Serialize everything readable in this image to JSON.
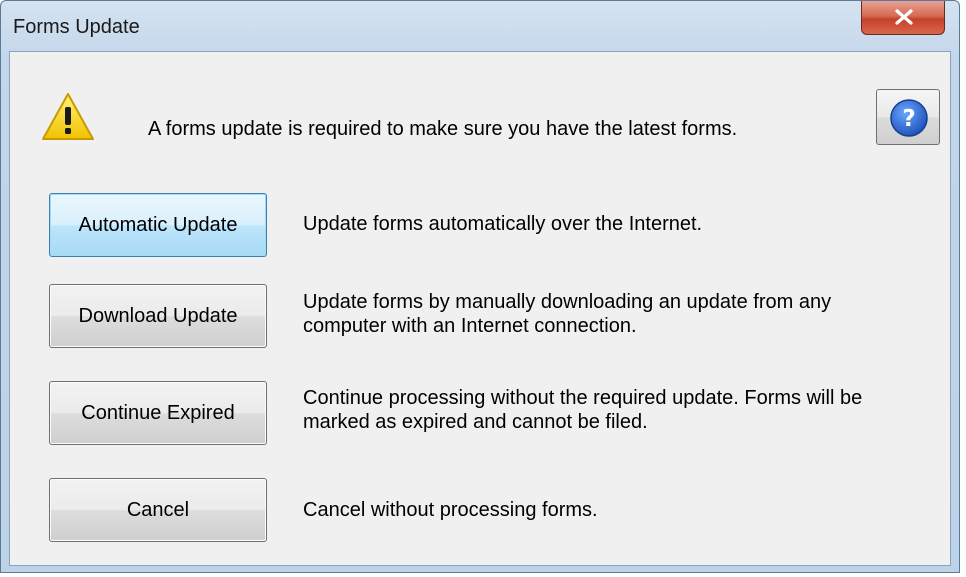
{
  "window": {
    "title": "Forms Update"
  },
  "message": "A forms update is required to make sure you have the latest forms.",
  "icons": {
    "warning": "warning-icon",
    "help": "help-icon",
    "close": "close-icon"
  },
  "options": [
    {
      "button": "Automatic Update",
      "description": "Update forms automatically over the Internet.",
      "default": true
    },
    {
      "button": "Download Update",
      "description_line1": "Update forms by manually downloading an update from any",
      "description_line2": "computer with an Internet connection."
    },
    {
      "button": "Continue Expired",
      "description_line1": "Continue processing without the required update. Forms will be",
      "description_line2": "marked as expired and cannot be filed."
    },
    {
      "button": "Cancel",
      "description": "Cancel without processing forms."
    }
  ],
  "colors": {
    "close_button": "#c4422a",
    "default_button": "#a7d9f5",
    "help_blue": "#2a5bc0"
  }
}
